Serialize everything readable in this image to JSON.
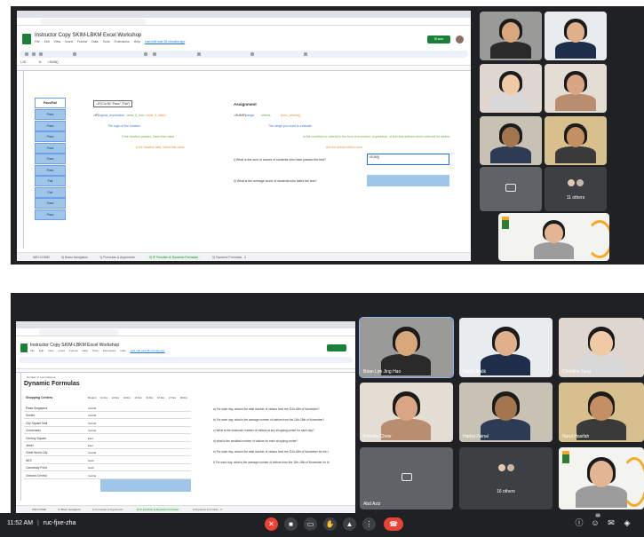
{
  "top": {
    "sheet": {
      "doc_title": "Instructor Copy SKIM-LBKM Excel Workshop",
      "menu": [
        "File",
        "Edit",
        "View",
        "Insert",
        "Format",
        "Data",
        "Tools",
        "Extensions",
        "Help",
        "Last edit was 38 minutes ago"
      ],
      "share_label": "Share",
      "name_box": "L18",
      "formula_value": "=SUM()",
      "left_header": "Pass/Fail",
      "pass_fail": [
        "Pass",
        "Pass",
        "Pass",
        "Pass",
        "Pass",
        "Pass",
        "Fail",
        "Fail",
        "Pass",
        "Pass"
      ],
      "if_formula": "=IF(C4>50,\"Pass\",\"Fail\")",
      "if_syntax_prefix": "=IF(",
      "if_syntax_1": "logical_expression,",
      "if_syntax_2": "value_if_true,",
      "if_syntax_3": "value_if_false)",
      "if_explain_1": "The logic of the function",
      "if_explain_2": "If the function passes, insert this value",
      "if_explain_3": "If the function fails, insert this value",
      "assignment_title": "Assignment",
      "sumif_prefix": "=SUMIF(",
      "sumif_1": "range,",
      "sumif_2": "criteria,",
      "sumif_3": "[sum_criteria])",
      "sumif_explain_1": "The range you want to evaluate",
      "sumif_explain_2": "Is the condition or criteria in the form of a number, expression, or text that defines which cells will be added",
      "sumif_explain_3": "Are the actual cells to sum",
      "question_1": "i) What is the sum of scores of students who have passed the test?",
      "answer_1": "=SUM()",
      "question_2": "ii) What is the average score of students who failed the test?",
      "tabs": [
        "WELCOME!",
        "0) Basic Navigation",
        "1) Formulas & Arguments",
        "2) IF Function & Dynamic Formulas",
        "3) Dynamic Formulas - 2"
      ],
      "active_tab": 3
    },
    "participants": [
      {
        "name": "",
        "skin": "#d9a77c",
        "shirt": "#2a2a2a",
        "bg": "#9a9a98"
      },
      {
        "name": "",
        "skin": "#e0b08a",
        "shirt": "#1d2d4a",
        "bg": "#e9ecef"
      },
      {
        "name": "",
        "skin": "#f0c9a6",
        "shirt": "#d8d8d8",
        "bg": "#ded6cf"
      },
      {
        "name": "",
        "skin": "#d9a582",
        "shirt": "#b98e70",
        "bg": "#e4ddd3"
      },
      {
        "name": "",
        "skin": "#a4764f",
        "shirt": "#2e3b55",
        "bg": "#c8c2b4"
      },
      {
        "name": "",
        "skin": "#c48f62",
        "shirt": "#3a3a3a",
        "bg": "#d7c08e"
      },
      {
        "name": "",
        "skin": "",
        "shirt": "",
        "bg": "#5f6368"
      },
      {
        "name": "11 others",
        "skin": "",
        "shirt": "",
        "bg": "#3c4043"
      },
      {
        "name": "",
        "skin": "#e3b594",
        "shirt": "#9c9c9c",
        "bg": "#f3f3f0"
      }
    ]
  },
  "bottom": {
    "sheet": {
      "doc_title": "Instructor Copy SKIM-LBKM Excel Workshop",
      "menu": [
        "File",
        "Edit",
        "View",
        "Insert",
        "Format",
        "Data",
        "Tools",
        "Extensions",
        "Help",
        "Last edit was 38 minutes ago"
      ],
      "heading": "Dynamic Formulas",
      "table_caption": "Number of Lorem/Ipsum",
      "col_shop": "Shopping Centers",
      "col_region": "Region",
      "day_headers": [
        "11-Nov",
        "12-Nov",
        "13-Nov",
        "14-Nov",
        "15-Nov",
        "16-Nov",
        "17-Nov",
        "18-Nov"
      ],
      "rows": [
        {
          "name": "Plaza Singapura",
          "region": "Central"
        },
        {
          "name": "Suntec",
          "region": "Central"
        },
        {
          "name": "City Square Mall",
          "region": "Central"
        },
        {
          "name": "Crossroads",
          "region": "Central"
        },
        {
          "name": "Century Square",
          "region": "East"
        },
        {
          "name": "Jewel",
          "region": "East"
        },
        {
          "name": "Great World City",
          "region": "Central"
        },
        {
          "name": "NEX",
          "region": "North"
        },
        {
          "name": "Causeway Point",
          "region": "North"
        },
        {
          "name": "Orchard Central",
          "region": "Central"
        }
      ],
      "questions": [
        "a) For each day, what is the total number of visitors from the 11th-18th of November?",
        "b) For each day, what is the average number of visitors from the 11th-18th of November?",
        "c) What is the maximum number of visitors at any shopping center for each day?",
        "d) what is the smallest number of visitors for each shopping center?",
        "e) For each day, what is the total number of visitors from the 11th-18th of November for the c",
        "f) For each day, what is the average number of visitors from the 11th-18th of November for th"
      ],
      "tabs": [
        "WELCOME!",
        "0) Basic Navigation",
        "1) Formulas & Arguments",
        "2) IF Function & Dynamic Formulas",
        "3) Dynamic Formulas - 2"
      ],
      "active_tab": 3
    },
    "participants": [
      {
        "name": "Brian Lim Jing Hao",
        "skin": "#d9a77c",
        "shirt": "#2a2a2a",
        "bg": "#9a9a98"
      },
      {
        "name": "Farah Malik",
        "skin": "#e0b08a",
        "shirt": "#1d2d4a",
        "bg": "#e9ecef"
      },
      {
        "name": "Christine Tang",
        "skin": "#f0c9a6",
        "shirt": "#d8d8d8",
        "bg": "#ded6cf"
      },
      {
        "name": "Priscilla Chew",
        "skin": "#d9a582",
        "shirt": "#b98e70",
        "bg": "#e4ddd3"
      },
      {
        "name": "Haikal Zainal",
        "skin": "#a4764f",
        "shirt": "#2e3b55",
        "bg": "#c8c2b4"
      },
      {
        "name": "Nurul Hasifah",
        "skin": "#c48f62",
        "shirt": "#3a3a3a",
        "bg": "#d7c08e"
      },
      {
        "name": "Abd Aziz",
        "skin": "",
        "shirt": "",
        "bg": "#5f6368"
      },
      {
        "name": "16 others",
        "skin": "",
        "shirt": "",
        "bg": "#3c4043"
      },
      {
        "name": "",
        "skin": "#e3b594",
        "shirt": "#9c9c9c",
        "bg": "#f3f3f0"
      }
    ]
  },
  "meet_bar": {
    "time": "11:52 AM",
    "separator": "|",
    "meeting_code": "ruc-fjxe-zha",
    "people_count": "28",
    "colors": {
      "end_call": "#ea4335",
      "muted": "#ea4335"
    }
  }
}
